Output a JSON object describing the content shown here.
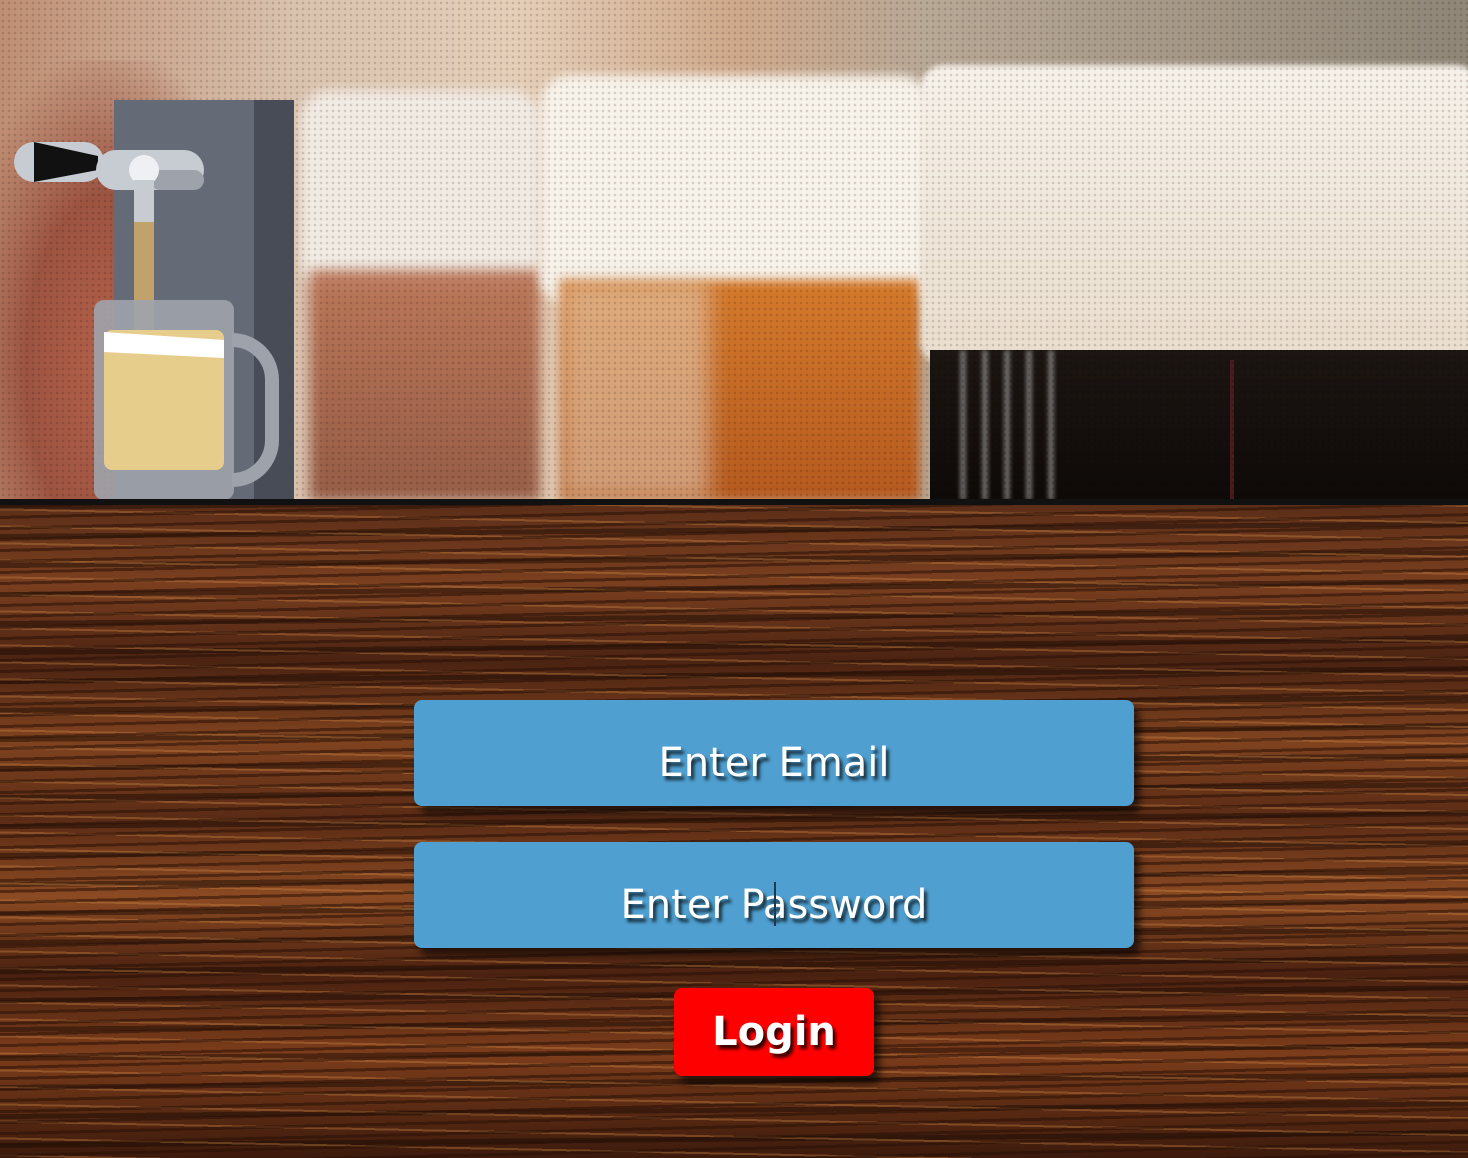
{
  "login_form": {
    "email_placeholder": "Enter Email",
    "password_placeholder": "Enter Password",
    "login_label": "Login"
  },
  "colors": {
    "field_bg": "#4f9fd0",
    "button_bg": "#ff0000",
    "text": "#ffffff",
    "divider": "#111111"
  },
  "icons": {
    "logo": "beer-tap-icon",
    "background_top": "beer-glasses-photo",
    "background_bottom": "wood-texture"
  }
}
